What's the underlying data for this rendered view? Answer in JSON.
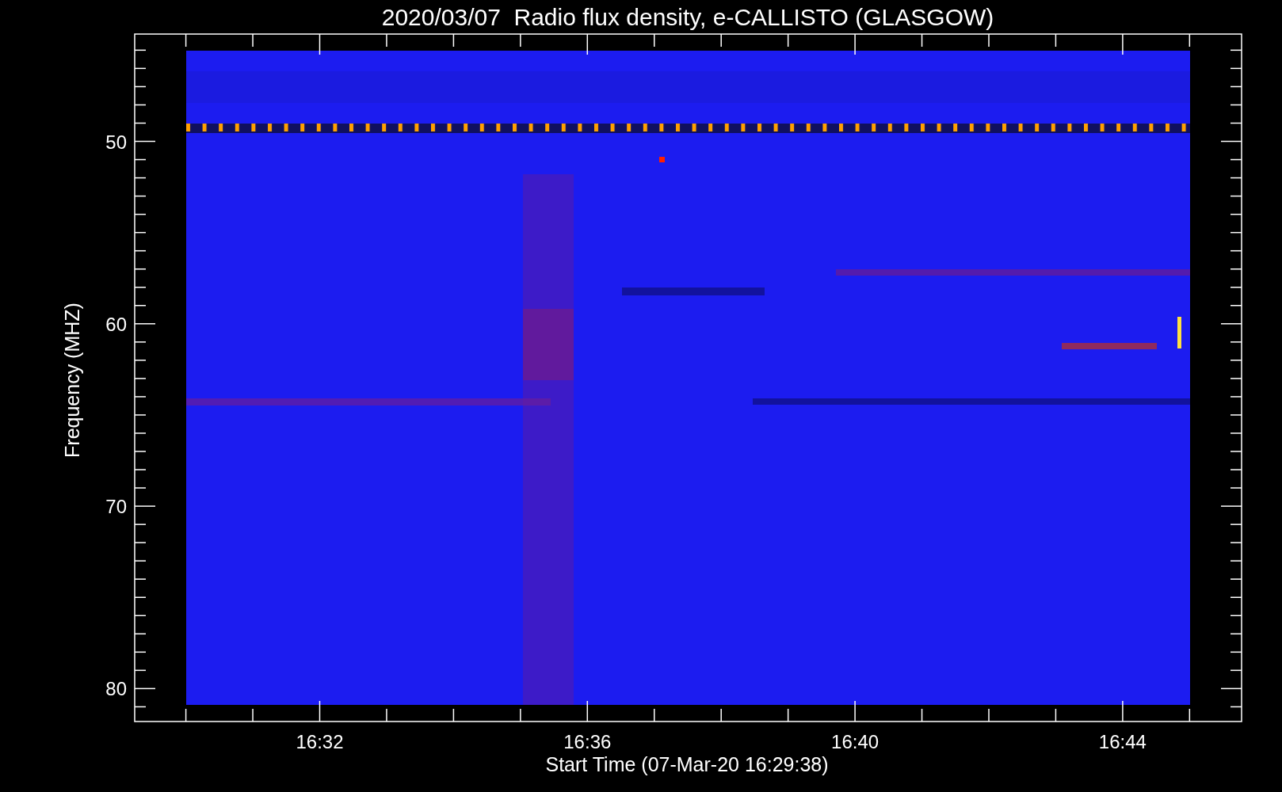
{
  "chart": {
    "title": "2020/03/07  Radio flux density, e-CALLISTO (GLASGOW)",
    "y_axis": {
      "label": "Frequency (MHZ)",
      "ticks": [
        "50",
        "60",
        "70",
        "80"
      ]
    },
    "x_axis": {
      "label": "Start Time (07-Mar-20 16:29:38)",
      "ticks": [
        "16:32",
        "16:36",
        "16:40",
        "16:44"
      ]
    }
  }
}
